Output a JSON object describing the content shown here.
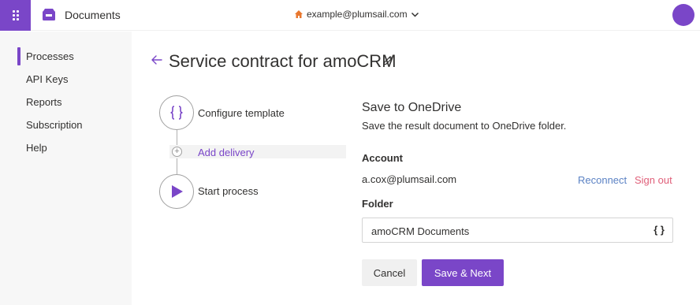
{
  "topbar": {
    "app_title": "Documents",
    "account_email": "example@plumsail.com",
    "waffle_icon": "waffle-icon",
    "app_icon": "inbox-tray-icon",
    "home_icon": "home-icon",
    "chevron_icon": "chevron-down-icon"
  },
  "sidebar": {
    "items": [
      {
        "label": "Processes",
        "active": true
      },
      {
        "label": "API Keys",
        "active": false
      },
      {
        "label": "Reports",
        "active": false
      },
      {
        "label": "Subscription",
        "active": false
      },
      {
        "label": "Help",
        "active": false
      }
    ]
  },
  "header": {
    "title": "Service contract for amoCRM",
    "back_icon": "arrow-left-icon",
    "edit_icon": "pencil-icon"
  },
  "steps": {
    "configure_label": "Configure template",
    "configure_icon": "braces-icon",
    "add_label": "Add delivery",
    "add_icon": "plus-icon",
    "start_label": "Start process",
    "start_icon": "play-icon"
  },
  "delivery": {
    "title": "Save to OneDrive",
    "description": "Save the result document to OneDrive folder.",
    "account_label": "Account",
    "account_value": "a.cox@plumsail.com",
    "reconnect_label": "Reconnect",
    "signout_label": "Sign out",
    "folder_label": "Folder",
    "folder_value": "amoCRM Documents",
    "folder_token": "{ }"
  },
  "actions": {
    "cancel_label": "Cancel",
    "save_label": "Save & Next"
  },
  "colors": {
    "accent": "#7a46c8",
    "link": "#5b82c4",
    "danger": "#e0607a",
    "home_icon": "#e8772e"
  }
}
